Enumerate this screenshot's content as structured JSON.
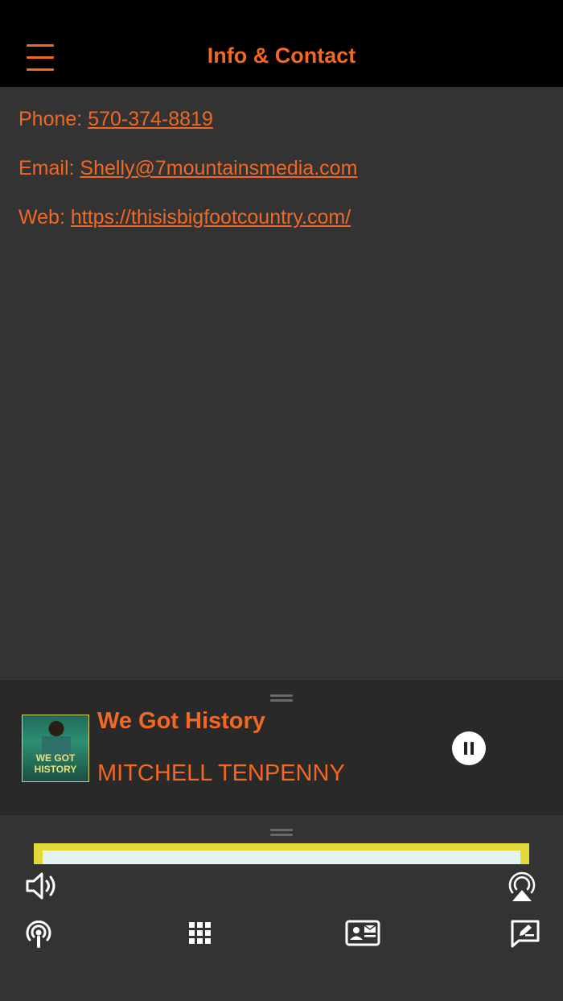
{
  "header": {
    "title": "Info & Contact",
    "menu_icon": "hamburger-menu-icon"
  },
  "contact": {
    "phone_label": "Phone: ",
    "phone_value": "570-374-8819",
    "email_label": "Email: ",
    "email_value": "Shelly@7mountainsmedia.com",
    "web_label": "Web: ",
    "web_value": "https://thisisbigfootcountry.com/"
  },
  "now_playing": {
    "song_title": "We Got History",
    "artist": "MITCHELL TENPENNY",
    "album_art_text": "WE GOT HISTORY",
    "state": "playing"
  },
  "toolbar": {
    "icons": [
      "volume-icon",
      "airplay-icon",
      "podcast-icon",
      "grid-icon",
      "contact-card-icon",
      "message-icon"
    ]
  },
  "colors": {
    "accent": "#f26722",
    "header_bg": "#000000",
    "content_bg": "#333333",
    "player_bg": "#292929",
    "banner_yellow": "#e2d93a"
  }
}
